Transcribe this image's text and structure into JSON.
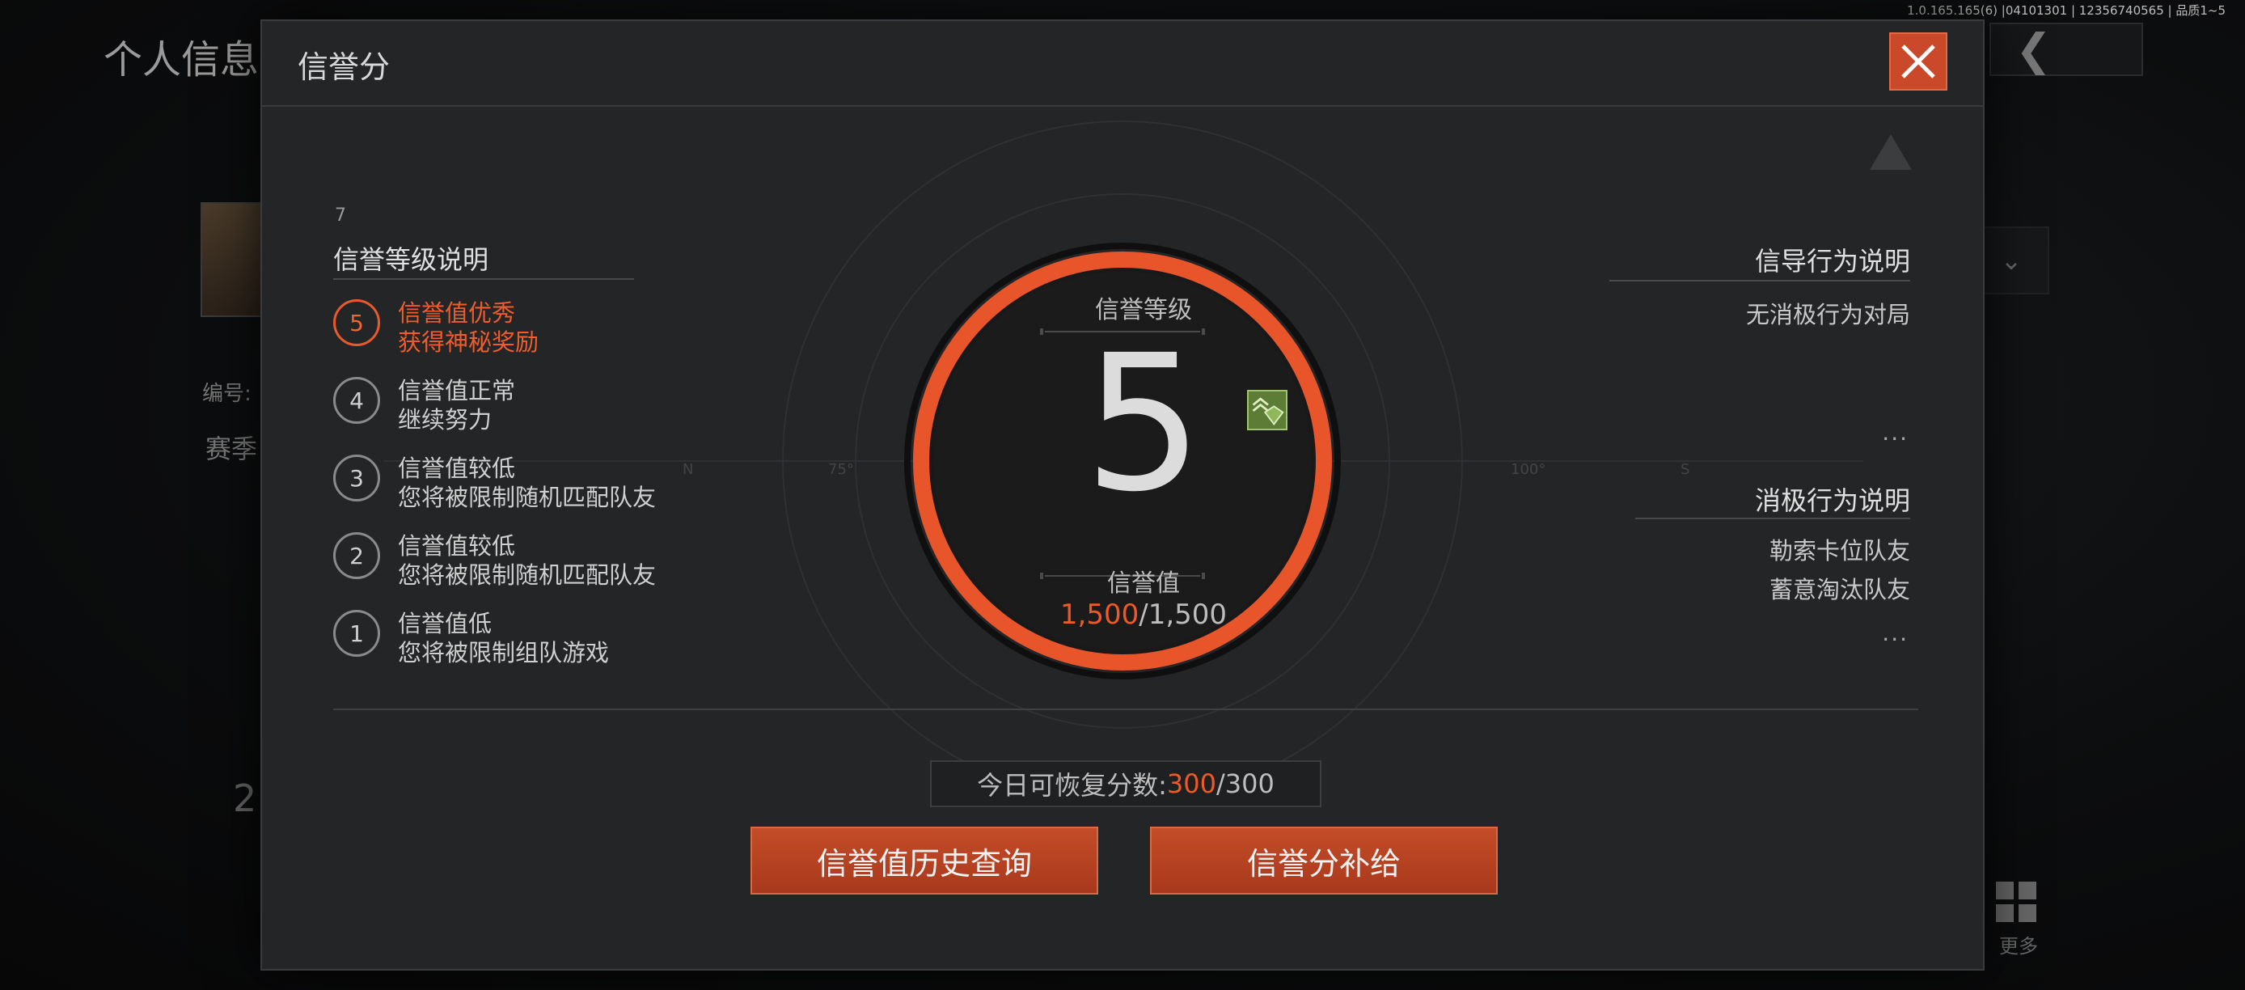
{
  "version": "1.0.165.165(6) |04101301 | 12356740565 | 品质1~5",
  "background": {
    "title": "个人信息",
    "labels": [
      "编号:",
      "赛季",
      "2",
      "更多"
    ]
  },
  "dialog": {
    "title": "信誉分",
    "close_icon": "close-x-icon",
    "left": {
      "heading": "信誉等级说明",
      "small_number": "7",
      "tiers": [
        {
          "level": "5",
          "line1": "信誉值优秀",
          "line2": "获得神秘奖励",
          "active": true
        },
        {
          "level": "4",
          "line1": "信誉值正常",
          "line2": "继续努力",
          "active": false
        },
        {
          "level": "3",
          "line1": "信誉值较低",
          "line2": "您将被限制随机匹配队友",
          "active": false
        },
        {
          "level": "2",
          "line1": "信誉值较低",
          "line2": "您将被限制随机匹配队友",
          "active": false
        },
        {
          "level": "1",
          "line1": "信誉值低",
          "line2": "您将被限制组队游戏",
          "active": false
        }
      ]
    },
    "center": {
      "level_label": "信誉等级",
      "level_value": "5",
      "score_label": "信誉值",
      "score_current": "1,500",
      "score_max": "/1,500",
      "ticks": [
        "N",
        "75°",
        "100°",
        "S"
      ]
    },
    "right": {
      "guide_heading": "信导行为说明",
      "guide_items": [
        "无消极行为对局"
      ],
      "guide_more": "...",
      "negative_heading": "消极行为说明",
      "negative_items": [
        "勒索卡位队友",
        "蓄意淘汰队友"
      ],
      "negative_more": "..."
    },
    "footer": {
      "recover_label": "今日可恢复分数:",
      "recover_current": "300",
      "recover_max": "/300",
      "history_button": "信誉值历史查询",
      "supply_button": "信誉分补给"
    }
  },
  "colors": {
    "accent": "#e8552a",
    "ring": "#e8552a",
    "button": "#b8431f",
    "panel": "#242527"
  }
}
